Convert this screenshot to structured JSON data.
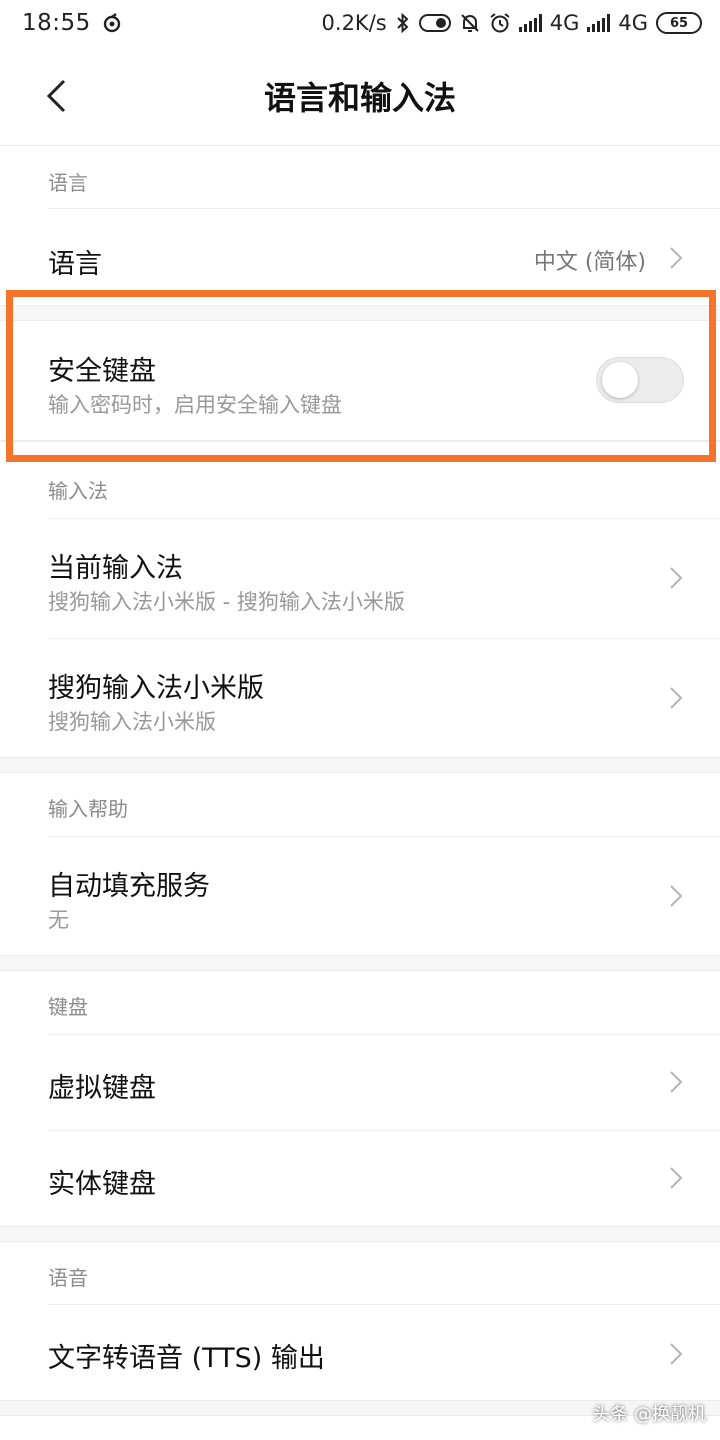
{
  "status_bar": {
    "time": "18:55",
    "net_speed": "0.2K/s",
    "signal1_label": "4G",
    "signal2_label": "4G",
    "battery": "65"
  },
  "header": {
    "title": "语言和输入法"
  },
  "sections": {
    "language": {
      "header": "语言",
      "items": [
        {
          "title": "语言",
          "value": "中文 (简体)"
        }
      ]
    },
    "secure_keyboard": {
      "title": "安全键盘",
      "subtitle": "输入密码时，启用安全输入键盘",
      "enabled": false
    },
    "input_method": {
      "header": "输入法",
      "items": [
        {
          "title": "当前输入法",
          "subtitle": "搜狗输入法小米版 - 搜狗输入法小米版"
        },
        {
          "title": "搜狗输入法小米版",
          "subtitle": "搜狗输入法小米版"
        }
      ]
    },
    "input_help": {
      "header": "输入帮助",
      "items": [
        {
          "title": "自动填充服务",
          "subtitle": "无"
        }
      ]
    },
    "keyboard": {
      "header": "键盘",
      "items": [
        {
          "title": "虚拟键盘"
        },
        {
          "title": "实体键盘"
        }
      ]
    },
    "speech": {
      "header": "语音",
      "items": [
        {
          "title": "文字转语音 (TTS) 输出"
        }
      ]
    }
  },
  "watermark": "头条 @换靓机",
  "colors": {
    "highlight": "#f5732b",
    "accent_text": "#111111",
    "secondary_text": "#999999"
  }
}
